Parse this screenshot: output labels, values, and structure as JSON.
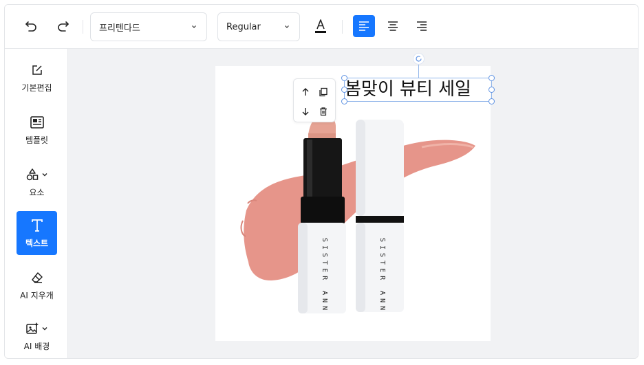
{
  "toolbar": {
    "font_family": "프리텐다드",
    "font_weight": "Regular"
  },
  "sidebar": {
    "items": [
      {
        "label": "기본편집"
      },
      {
        "label": "템플릿"
      },
      {
        "label": "요소"
      },
      {
        "label": "텍스트"
      },
      {
        "label": "AI 지우개"
      },
      {
        "label": "AI 배경"
      }
    ]
  },
  "canvas": {
    "text": "봄맞이 뷰티 세일",
    "product_brand": "SISTER ANN"
  },
  "colors": {
    "accent": "#1677ff",
    "swatch": "#e6958a"
  }
}
